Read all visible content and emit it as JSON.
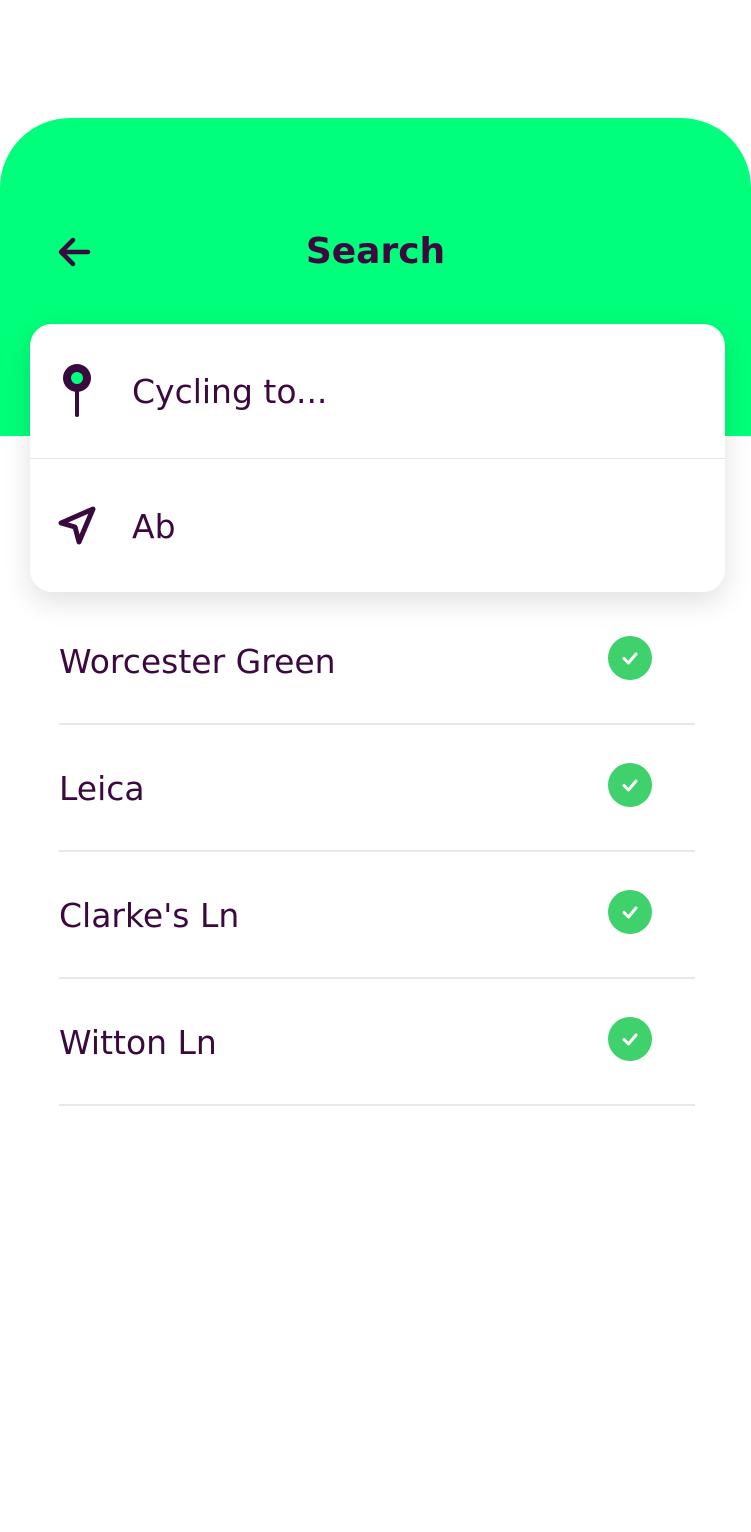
{
  "header": {
    "title": "Search",
    "back_icon": "arrow-left-icon",
    "background_color": "#00ff7a",
    "text_color": "#3a0a3f"
  },
  "search": {
    "destination_placeholder": "Cycling to...",
    "destination_icon": "map-pin-icon",
    "origin_value": "Ab",
    "origin_icon": "navigation-arrow-icon"
  },
  "results": [
    {
      "label": "Worcester Green",
      "status_icon": "check-circle-icon"
    },
    {
      "label": "Leica",
      "status_icon": "check-circle-icon"
    },
    {
      "label": "Clarke's Ln",
      "status_icon": "check-circle-icon"
    },
    {
      "label": "Witton Ln",
      "status_icon": "check-circle-icon"
    }
  ],
  "colors": {
    "accent_green": "#00ff7a",
    "check_green": "#3fd16b",
    "text_purple": "#3a0a3f"
  }
}
